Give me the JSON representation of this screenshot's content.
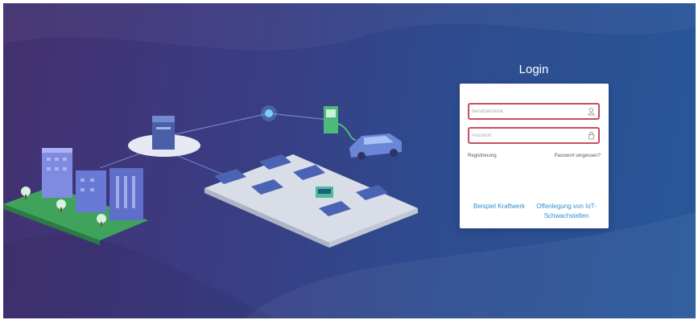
{
  "login": {
    "title": "Login",
    "username_placeholder": "Benutzername",
    "password_placeholder": "Passwort",
    "register_label": "Registrierung",
    "forgot_password_label": "Passwort vergessen?",
    "demo_plant_label": "Beispiel Kraftwerk",
    "iot_disclosure_line1": "Offenlegung von IoT-",
    "iot_disclosure_line2": "Schwachstellen"
  },
  "icons": {
    "username_field": "user-icon",
    "password_field": "lock-icon"
  },
  "colors": {
    "background_start": "#43306f",
    "background_end": "#27589a",
    "field_border": "#c94e5e",
    "link": "#2f8fd3"
  }
}
